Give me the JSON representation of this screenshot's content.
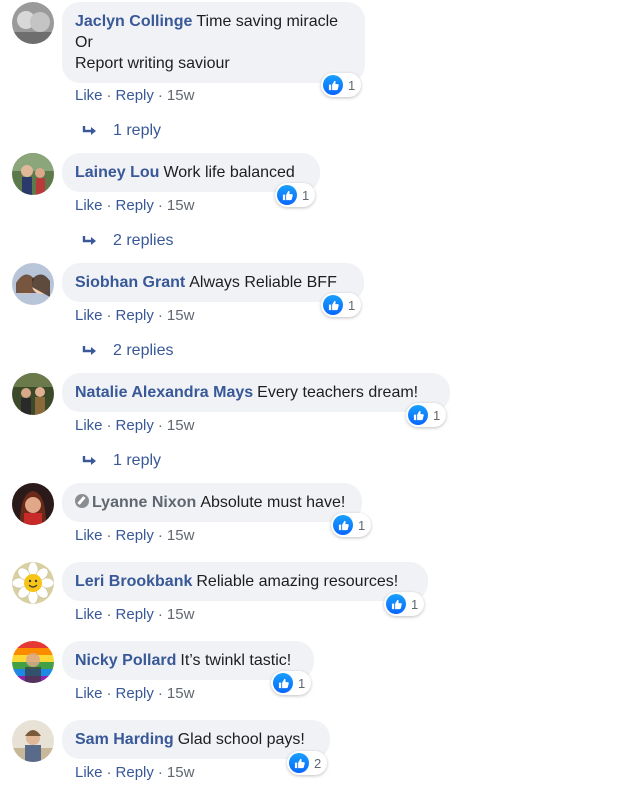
{
  "actions": {
    "like": "Like",
    "reply": "Reply",
    "sep": "·"
  },
  "comments": [
    {
      "author": "Jaclyn Collinge",
      "lines": [
        "Time saving miracle",
        "Or",
        "Report writing saviour"
      ],
      "reactions": "1",
      "time": "15w",
      "replies": "1 reply"
    },
    {
      "author": "Lainey Lou",
      "lines": [
        "Work life balanced"
      ],
      "reactions": "1",
      "time": "15w",
      "replies": "2 replies"
    },
    {
      "author": "Siobhan Grant",
      "lines": [
        "Always Reliable BFF"
      ],
      "reactions": "1",
      "time": "15w",
      "replies": "2 replies"
    },
    {
      "author": "Natalie Alexandra Mays",
      "lines": [
        "Every teachers dream!"
      ],
      "reactions": "1",
      "time": "15w",
      "replies": "1 reply"
    },
    {
      "author": "Lyanne Nixon",
      "lines": [
        "Absolute must have!"
      ],
      "reactions": "1",
      "time": "15w"
    },
    {
      "author": "Leri Brookbank",
      "lines": [
        "Reliable amazing resources!"
      ],
      "reactions": "1",
      "time": "15w"
    },
    {
      "author": "Nicky Pollard",
      "lines": [
        "It’s twinkl tastic!"
      ],
      "reactions": "1",
      "time": "15w"
    },
    {
      "author": "Sam Harding",
      "lines": [
        "Glad school pays!"
      ],
      "reactions": "2",
      "time": "15w"
    }
  ]
}
